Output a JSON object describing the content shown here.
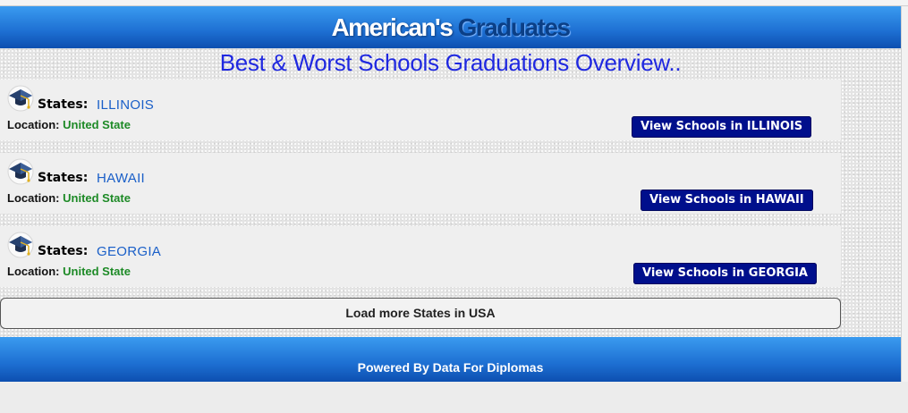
{
  "header": {
    "brand_white": "American's",
    "brand_dark": "Graduates"
  },
  "subtitle": "Best & Worst Schools Graduations Overview..",
  "states": [
    {
      "label": "States:",
      "name": "ILLINOIS",
      "location_label": "Location:",
      "location_value": "United State",
      "button": "View Schools in ILLINOIS"
    },
    {
      "label": "States:",
      "name": "HAWAII",
      "location_label": "Location:",
      "location_value": "United State",
      "button": "View Schools in HAWAII"
    },
    {
      "label": "States:",
      "name": "GEORGIA",
      "location_label": "Location:",
      "location_value": "United State",
      "button": "View Schools in GEORGIA"
    }
  ],
  "load_more": "Load more States in USA",
  "footer": "Powered By Data For Diplomas",
  "icons": {
    "state": "graduation-cap-icon"
  },
  "colors": {
    "header_blue": "#1d6fd2",
    "button_navy": "#000f8c",
    "state_link": "#1a5fc8",
    "location_green": "#1d8a26",
    "subtitle_blue": "#1f28e0"
  }
}
